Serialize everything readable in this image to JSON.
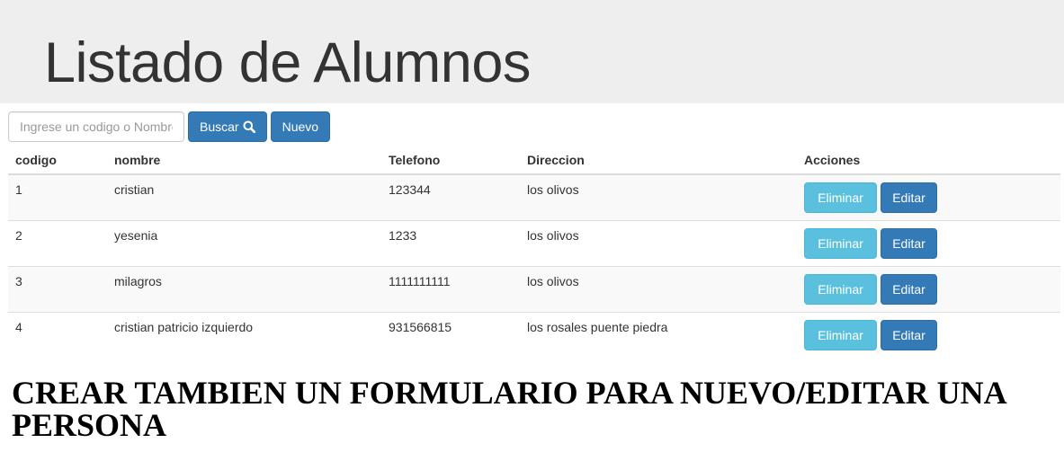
{
  "header": {
    "title": "Listado de Alumnos"
  },
  "search": {
    "placeholder": "Ingrese un codigo o Nombre",
    "search_label": "Buscar",
    "new_label": "Nuevo"
  },
  "table": {
    "columns": [
      "codigo",
      "nombre",
      "Telefono",
      "Direccion",
      "Acciones"
    ],
    "rows": [
      {
        "codigo": "1",
        "nombre": "cristian",
        "telefono": "123344",
        "direccion": "los olivos"
      },
      {
        "codigo": "2",
        "nombre": "yesenia",
        "telefono": "1233",
        "direccion": "los olivos"
      },
      {
        "codigo": "3",
        "nombre": "milagros",
        "telefono": "1111111111",
        "direccion": "los olivos"
      },
      {
        "codigo": "4",
        "nombre": "cristian patricio izquierdo",
        "telefono": "931566815",
        "direccion": "los rosales puente piedra"
      }
    ],
    "delete_label": "Eliminar",
    "edit_label": "Editar"
  },
  "note": {
    "text": "CREAR TAMBIEN UN FORMULARIO PARA NUEVO/EDITAR UNA PERSONA"
  },
  "colors": {
    "primary": "#337ab7",
    "info": "#5bc0de",
    "jumbotron": "#eeeeee"
  }
}
